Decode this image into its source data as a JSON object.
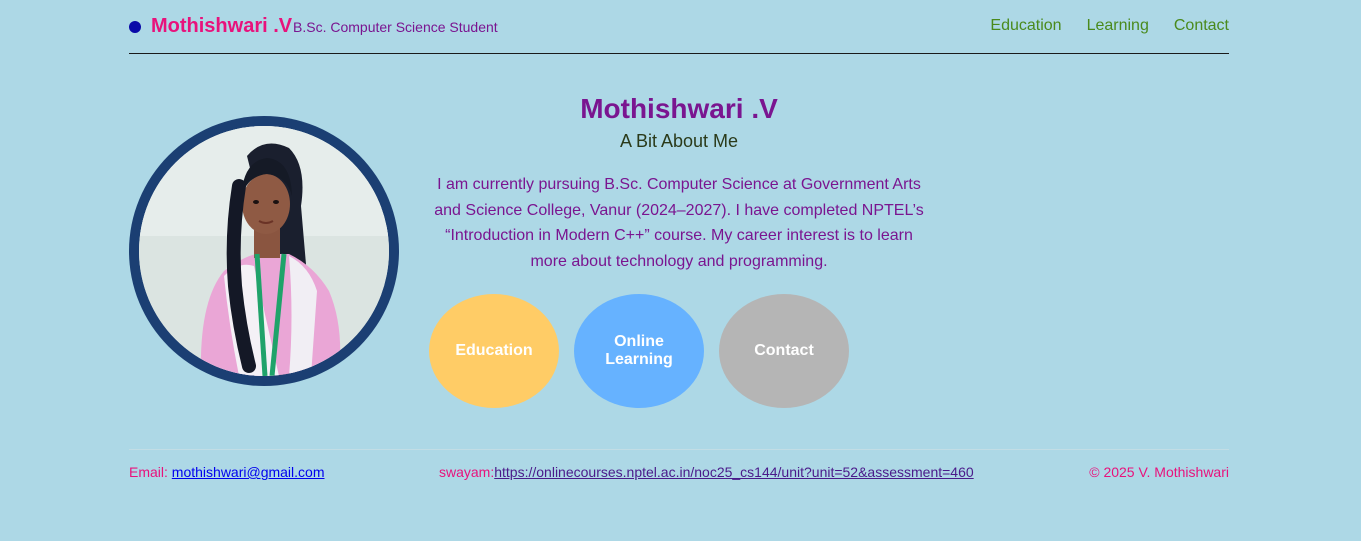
{
  "header": {
    "brand_name": "Mothishwari .V",
    "brand_subtitle": "B.Sc. Computer Science Student",
    "nav": [
      "Education",
      "Learning",
      "Contact"
    ]
  },
  "profile": {
    "photo_icon": "profile-photo"
  },
  "main": {
    "title": "Mothishwari .V",
    "subtitle": "A Bit About Me",
    "bio": "I am currently pursuing B.Sc. Computer Science at Government Arts and Science College, Vanur (2024–2027). I have completed NPTEL’s “Introduction in Modern C++” course. My career interest is to learn more about technology and programming.",
    "buttons": {
      "education": "Education",
      "learning": "Online Learning",
      "contact": "Contact"
    }
  },
  "footer": {
    "email_label": "Email: ",
    "email": "mothishwari@gmail.com",
    "swayam_label": "swayam:",
    "swayam_url": "https://onlinecourses.nptel.ac.in/noc25_cs144/unit?unit=52&assessment=460",
    "copyright": "© 2025 V. Mothishwari"
  },
  "colors": {
    "background": "#add8e6",
    "brand": "#e8127c",
    "accent_purple": "#7a1590",
    "nav_green": "#4a8a1c",
    "education_circle": "#ffcc66",
    "learning_circle": "#66b2ff",
    "contact_circle": "#b5b5b5",
    "avatar_ring": "#1b3f73"
  }
}
